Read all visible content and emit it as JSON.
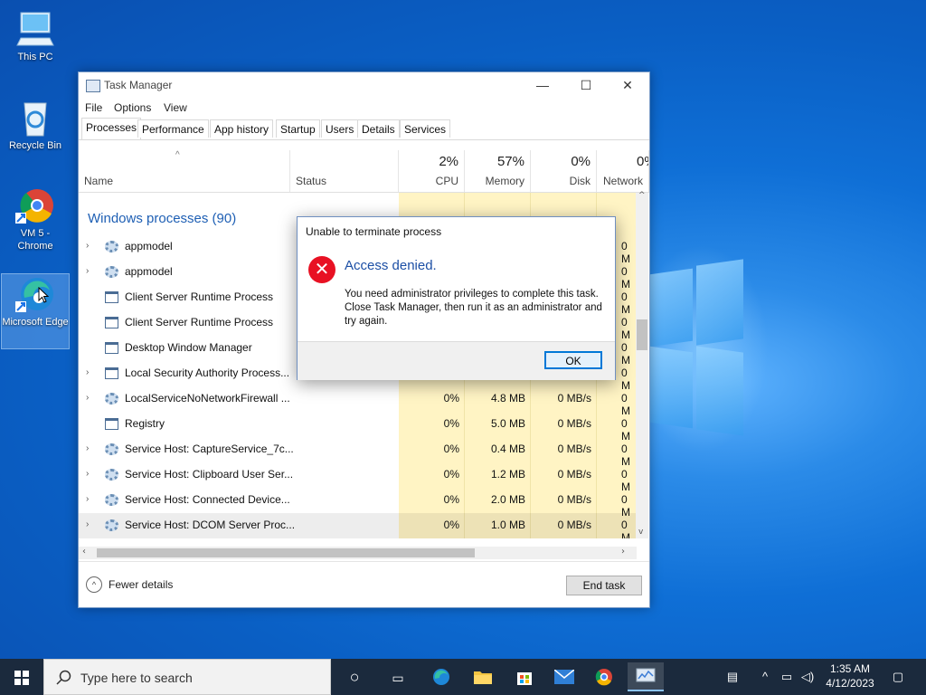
{
  "desktop": {
    "icons": [
      {
        "label": "This PC"
      },
      {
        "label": "Recycle Bin"
      },
      {
        "label": "VM 5 - Chrome"
      },
      {
        "label": "Microsoft Edge"
      }
    ]
  },
  "taskmanager": {
    "title": "Task Manager",
    "menu": [
      "File",
      "Options",
      "View"
    ],
    "tabs": [
      "Processes",
      "Performance",
      "App history",
      "Startup",
      "Users",
      "Details",
      "Services"
    ],
    "columns": {
      "name": "Name",
      "status": "Status",
      "cpu": {
        "pct": "2%",
        "label": "CPU"
      },
      "memory": {
        "pct": "57%",
        "label": "Memory"
      },
      "disk": {
        "pct": "0%",
        "label": "Disk"
      },
      "network": {
        "pct": "0%",
        "label": "Network"
      }
    },
    "group": "Windows processes (90)",
    "rows": [
      {
        "name": "appmodel",
        "cpu": "",
        "mem": "",
        "disk": "",
        "net": "0 M"
      },
      {
        "name": "appmodel",
        "cpu": "",
        "mem": "",
        "disk": "",
        "net": "0 M"
      },
      {
        "name": "Client Server Runtime Process",
        "cpu": "",
        "mem": "",
        "disk": "",
        "net": "0 M"
      },
      {
        "name": "Client Server Runtime Process",
        "cpu": "",
        "mem": "",
        "disk": "",
        "net": "0 M"
      },
      {
        "name": "Desktop Window Manager",
        "cpu": "",
        "mem": "",
        "disk": "",
        "net": "0 M"
      },
      {
        "name": "Local Security Authority Process...",
        "cpu": "",
        "mem": "",
        "disk": "",
        "net": "0 M"
      },
      {
        "name": "LocalServiceNoNetworkFirewall ...",
        "cpu": "0%",
        "mem": "4.8 MB",
        "disk": "0 MB/s",
        "net": "0 M"
      },
      {
        "name": "Registry",
        "cpu": "0%",
        "mem": "5.0 MB",
        "disk": "0 MB/s",
        "net": "0 M"
      },
      {
        "name": "Service Host: CaptureService_7c...",
        "cpu": "0%",
        "mem": "0.4 MB",
        "disk": "0 MB/s",
        "net": "0 M"
      },
      {
        "name": "Service Host: Clipboard User Ser...",
        "cpu": "0%",
        "mem": "1.2 MB",
        "disk": "0 MB/s",
        "net": "0 M"
      },
      {
        "name": "Service Host: Connected Device...",
        "cpu": "0%",
        "mem": "2.0 MB",
        "disk": "0 MB/s",
        "net": "0 M"
      },
      {
        "name": "Service Host: DCOM Server Proc...",
        "cpu": "0%",
        "mem": "1.0 MB",
        "disk": "0 MB/s",
        "net": "0 M"
      }
    ],
    "footer": {
      "fewer_details": "Fewer details",
      "end_task": "End task"
    }
  },
  "dialog": {
    "title": "Unable to terminate process",
    "heading": "Access denied.",
    "message": "You need administrator privileges to complete this task. Close Task Manager, then run it as an administrator and try again.",
    "ok": "OK"
  },
  "taskbar": {
    "search_placeholder": "Type here to search",
    "time": "1:35 AM",
    "date": "4/12/2023"
  },
  "colors": {
    "accent": "#0078d7",
    "error": "#e81123",
    "group_heading": "#1e5fb4"
  }
}
